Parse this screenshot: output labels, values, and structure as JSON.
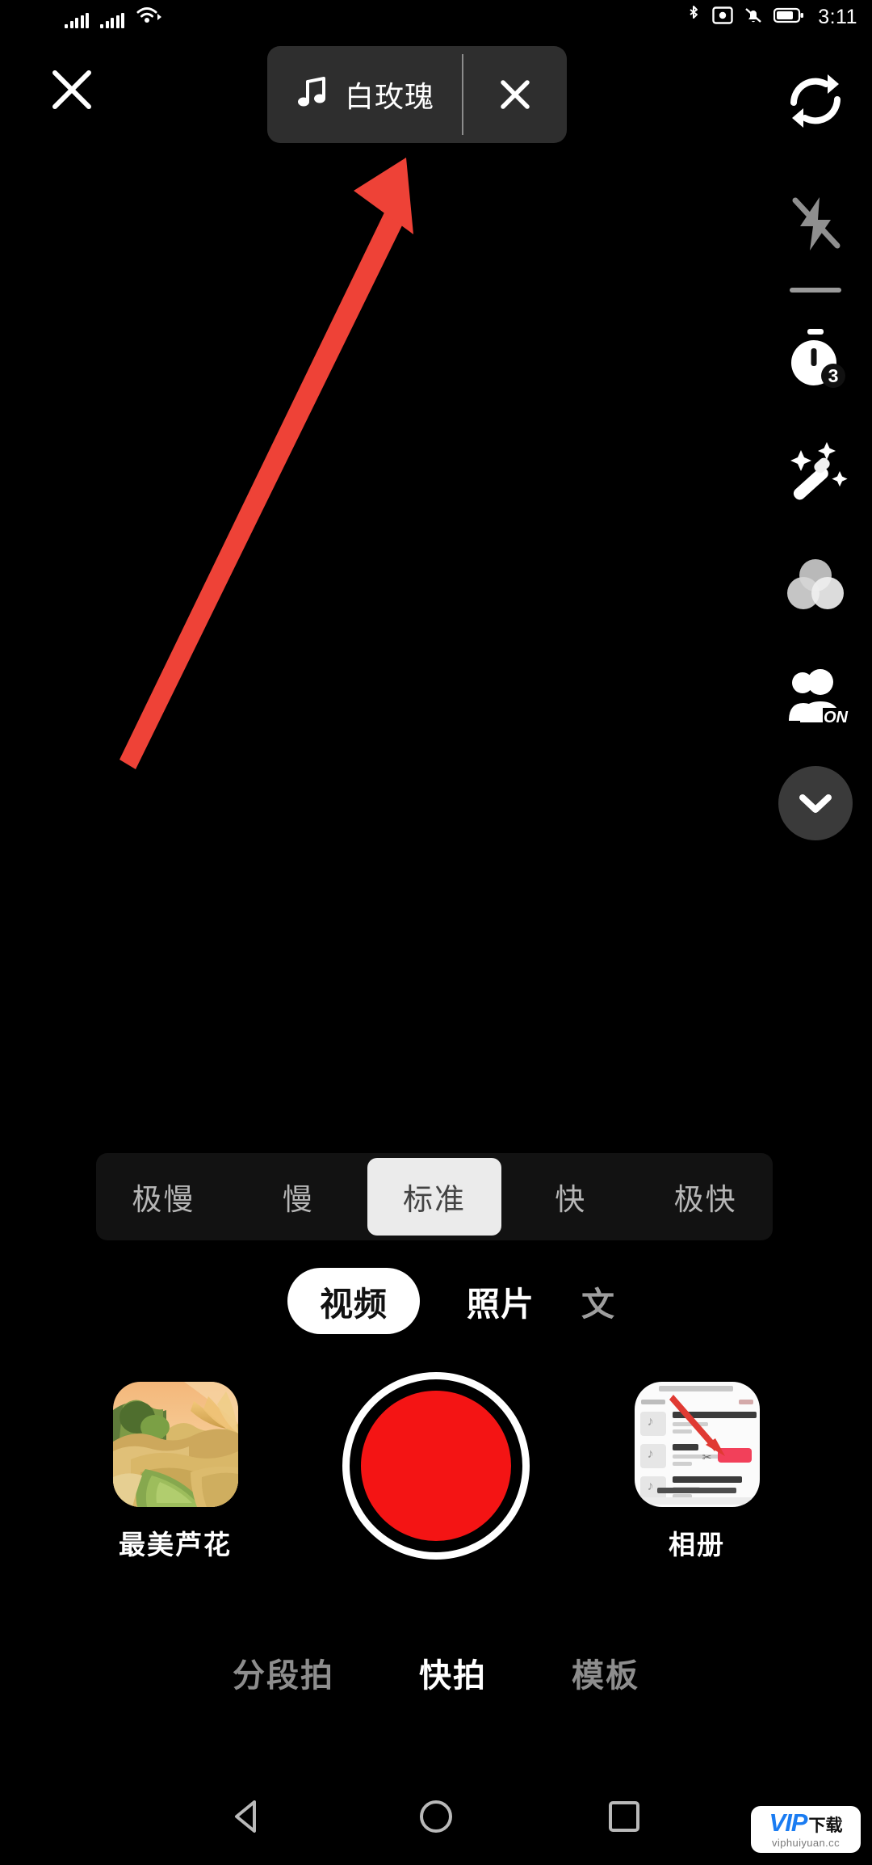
{
  "status_bar": {
    "time": "3:11",
    "icons": [
      "signal-bars-icon",
      "signal-bars-icon",
      "wifi-icon",
      "bluetooth-icon",
      "screenshot-icon",
      "bell-off-icon",
      "battery-icon"
    ]
  },
  "top_bar": {
    "close_icon": "close-icon",
    "music": {
      "note_icon": "music-note-icon",
      "title": "白玫瑰",
      "remove_icon": "close-icon"
    }
  },
  "right_rail": {
    "items": [
      {
        "name": "flip-camera-icon",
        "label": "翻转"
      },
      {
        "name": "flash-off-icon",
        "label": "闪光灯关"
      },
      {
        "name": "timer-icon",
        "label": "倒计时",
        "badge": "3"
      },
      {
        "name": "beauty-wand-icon",
        "label": "美颜"
      },
      {
        "name": "filters-icon",
        "label": "滤镜"
      },
      {
        "name": "portrait-on-icon",
        "label": "人像",
        "badge": "ON"
      },
      {
        "name": "chevron-down-icon",
        "label": "展开"
      }
    ]
  },
  "speed_selector": {
    "options": [
      "极慢",
      "慢",
      "标准",
      "快",
      "极快"
    ],
    "selected": "标准",
    "selected_index": 2
  },
  "mode_tabs": {
    "items": [
      "视频",
      "照片",
      "文"
    ],
    "selected": "视频"
  },
  "capture_row": {
    "effect": {
      "label": "最美芦花",
      "thumb": "landscape-reeds-thumbnail"
    },
    "record_button": {
      "name": "record-button",
      "color": "#f41414"
    },
    "album": {
      "label": "相册",
      "thumb": "music-list-screenshot-thumbnail"
    }
  },
  "bottom_tabs": {
    "items": [
      "分段拍",
      "快拍",
      "模板"
    ],
    "selected": "快拍"
  },
  "nav_bar": {
    "back": "back-triangle-icon",
    "home": "home-circle-icon",
    "recents": "recents-square-icon"
  },
  "annotation": {
    "arrow": "red-pointer-arrow",
    "color": "#ee4237"
  },
  "watermark": {
    "brand": "VIP",
    "suffix": "下载",
    "url": "viphuiyuan.cc",
    "accent": "#1a7cf2"
  }
}
